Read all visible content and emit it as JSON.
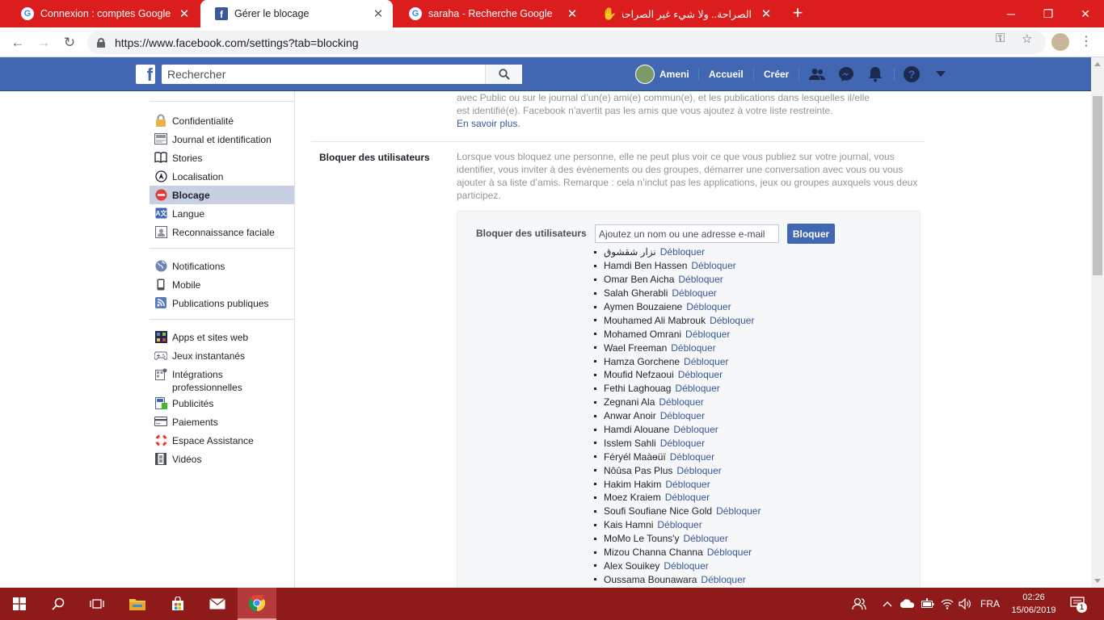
{
  "browser": {
    "tabs": [
      {
        "title": "Connexion : comptes Google",
        "favicon": "google-icon",
        "active": false
      },
      {
        "title": "Gérer le blocage",
        "favicon": "facebook-icon",
        "active": true
      },
      {
        "title": "saraha - Recherche Google",
        "favicon": "google-icon",
        "active": false
      },
      {
        "title": "الصراحة.. ولا شيء غير الصراحة",
        "favicon": "hand-icon",
        "active": false
      }
    ],
    "url": "https://www.facebook.com/settings?tab=blocking"
  },
  "fb_header": {
    "search_placeholder": "Rechercher",
    "user_name": "Ameni",
    "home_label": "Accueil",
    "create_label": "Créer"
  },
  "sidebar": {
    "sections": [
      {
        "items": [
          {
            "label": "Confidentialité",
            "icon": "lock-icon"
          },
          {
            "label": "Journal et identification",
            "icon": "timeline-icon"
          },
          {
            "label": "Stories",
            "icon": "book-icon"
          },
          {
            "label": "Localisation",
            "icon": "location-icon"
          },
          {
            "label": "Blocage",
            "icon": "block-icon",
            "active": true
          },
          {
            "label": "Langue",
            "icon": "language-icon"
          },
          {
            "label": "Reconnaissance faciale",
            "icon": "face-recognition-icon"
          }
        ]
      },
      {
        "items": [
          {
            "label": "Notifications",
            "icon": "globe-icon"
          },
          {
            "label": "Mobile",
            "icon": "mobile-icon"
          },
          {
            "label": "Publications publiques",
            "icon": "rss-icon"
          }
        ]
      },
      {
        "items": [
          {
            "label": "Apps et sites web",
            "icon": "apps-icon"
          },
          {
            "label": "Jeux instantanés",
            "icon": "gamepad-icon"
          },
          {
            "label": "Intégrations professionnelles",
            "icon": "business-icon"
          },
          {
            "label": "Publicités",
            "icon": "ads-icon"
          },
          {
            "label": "Paiements",
            "icon": "card-icon"
          },
          {
            "label": "Espace Assistance",
            "icon": "lifebuoy-icon"
          },
          {
            "label": "Vidéos",
            "icon": "film-icon"
          }
        ]
      }
    ]
  },
  "main": {
    "restricted_text": "avec Public ou sur le journal d’un(e) ami(e) commun(e), et les publications dans lesquelles il/elle est identifié(e). Facebook n’avertit pas les amis que vous ajoutez à votre liste restreinte.",
    "learn_more": "En savoir plus.",
    "block_users_title": "Bloquer des utilisateurs",
    "block_users_desc": "Lorsque vous bloquez une personne, elle ne peut plus voir ce que vous publiez sur votre journal, vous identifier, vous inviter à des évènements ou des groupes, démarrer une conversation avec vous ou vous ajouter à sa liste d’amis. Remarque : cela n’inclut pas les applications, jeux ou groupes auxquels vous deux participez.",
    "block_box": {
      "label": "Bloquer des utilisateurs",
      "input_placeholder": "Ajoutez un nom ou une adresse e-mail",
      "button_label": "Bloquer",
      "unblock_label": "Débloquer",
      "blocked": [
        "نزار شقشوق",
        "Hamdi Ben Hassen",
        "Omar Ben Aicha",
        "Salah Gherabli",
        "Aymen Bouzaiene",
        "Mouhamed Ali Mabrouk",
        "Mohamed Omrani",
        "Wael Freeman",
        "Hamza Gorchene",
        "Moufid Nefzaoui",
        "Fethi Laghouag",
        "Zegnani Ala",
        "Anwar Anoir",
        "Hamdi Alouane",
        "Isslem Sahli",
        "Féryél Maàɵüï",
        "Nôûsa Pas Plus",
        "Hakim Hakim",
        "Moez Kraiem",
        "Soufi Soufiane Nice Gold",
        "Kais Hamni",
        "MoMo Le Touns'y",
        "Mizou Channa Channa",
        "Alex Souikey",
        "Oussama Bounawara"
      ]
    }
  },
  "taskbar": {
    "language": "FRA",
    "time": "02:26",
    "date": "15/06/2019",
    "notification_count": "1"
  },
  "colors": {
    "chrome_red": "#dc1d1d",
    "facebook_blue": "#4267b2",
    "link_blue": "#365899",
    "taskbar": "#8f1a1a"
  }
}
